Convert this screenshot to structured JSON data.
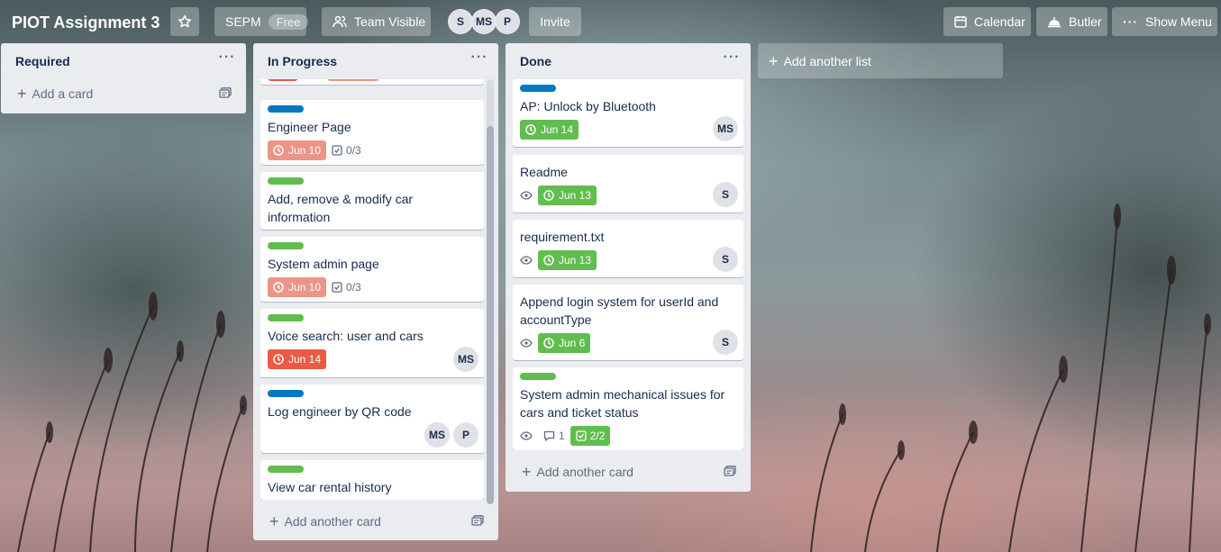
{
  "header": {
    "board_title": "PIOT Assignment 3",
    "team_name": "SEPM",
    "team_badge": "Free",
    "visibility": "Team Visible",
    "members": [
      "S",
      "MS",
      "P"
    ],
    "invite_label": "Invite",
    "calendar_label": "Calendar",
    "butler_label": "Butler",
    "menu_label": "Show Menu"
  },
  "lists": [
    {
      "title": "Required",
      "add_card": "Add a card",
      "cards": []
    },
    {
      "title": "In Progress",
      "add_card": "Add another card",
      "cards": [
        {
          "title": "Engineer Page",
          "label_color": "#0079bf",
          "due": "Jun 10",
          "due_state": "overdue-light",
          "checklist": "0/3",
          "members": []
        },
        {
          "title": "Add, remove & modify car information",
          "label_color": "#61bd4f",
          "members": []
        },
        {
          "title": "System admin page",
          "label_color": "#61bd4f",
          "due": "Jun 10",
          "due_state": "overdue-light",
          "checklist": "0/3",
          "members": []
        },
        {
          "title": "Voice search: user and cars",
          "label_color": "#61bd4f",
          "due": "Jun 14",
          "due_state": "overdue",
          "members": [
            "MS"
          ]
        },
        {
          "title": "Log engineer by QR code",
          "label_color": "#0079bf",
          "members": [
            "MS",
            "P"
          ]
        },
        {
          "title": "View car rental history",
          "label_color": "#61bd4f",
          "members": []
        }
      ]
    },
    {
      "title": "Done",
      "add_card": "Add another card",
      "cards": [
        {
          "title": "AP: Unlock by Bluetooth",
          "label_color": "#0079bf",
          "due": "Jun 14",
          "due_state": "complete",
          "members": [
            "MS"
          ]
        },
        {
          "title": "Readme",
          "due": "Jun 13",
          "due_state": "complete",
          "watching": true,
          "members": [
            "S"
          ]
        },
        {
          "title": "requirement.txt",
          "due": "Jun 13",
          "due_state": "complete",
          "watching": true,
          "members": [
            "S"
          ]
        },
        {
          "title": "Append login system for userId and accountType",
          "due": "Jun 6",
          "due_state": "complete",
          "watching": true,
          "members": [
            "S"
          ]
        },
        {
          "title": "System admin mechanical issues for cars and ticket status",
          "label_color": "#61bd4f",
          "watching": true,
          "comments": "1",
          "checklist": "2/2",
          "members": []
        }
      ]
    }
  ],
  "add_list_label": "Add another list",
  "colors": {
    "label_green": "#61bd4f",
    "label_blue": "#0079bf",
    "due_red": "#eb5a46",
    "due_salmon": "#ec9488",
    "list_bg": "#ebecf0"
  },
  "icons": {
    "star": "star-icon",
    "visibility": "team-icon",
    "calendar": "calendar-icon",
    "butler": "butler-bell-icon",
    "menu": "ellipsis-icon",
    "clock": "clock-icon",
    "checklist": "checklist-icon",
    "watch": "eye-icon",
    "comment": "comment-icon",
    "template": "card-template-icon"
  }
}
